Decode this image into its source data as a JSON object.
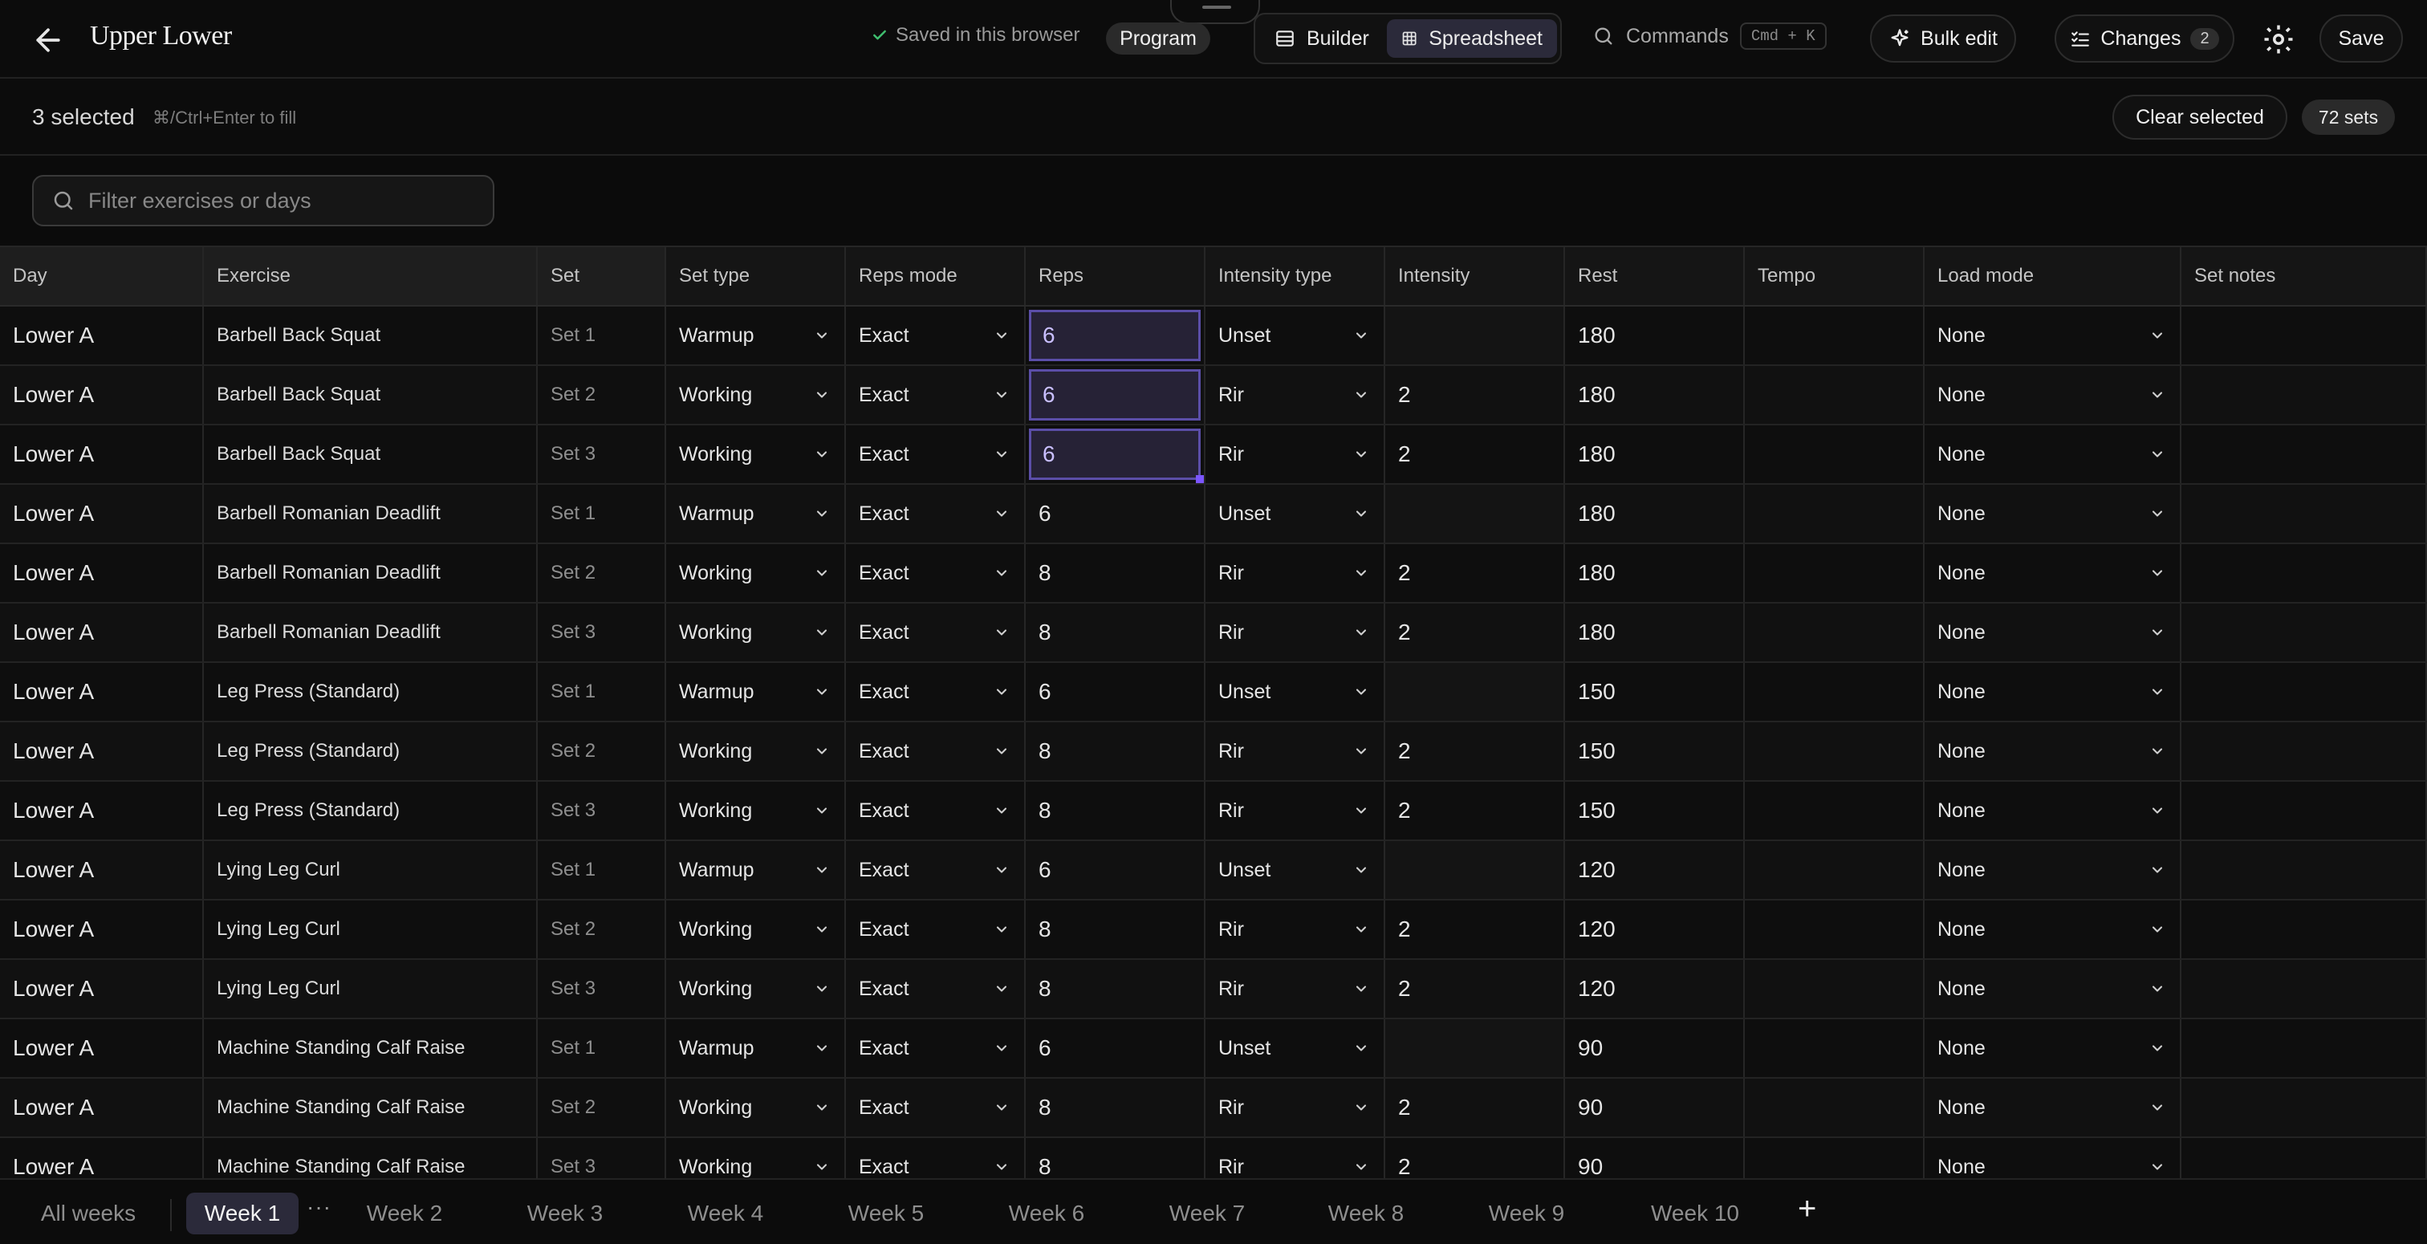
{
  "header": {
    "title": "Upper Lower",
    "saved_status": "Saved in this browser",
    "program_label": "Program",
    "view_builder": "Builder",
    "view_spreadsheet": "Spreadsheet",
    "commands_label": "Commands",
    "commands_shortcut": "Cmd + K",
    "bulk_edit_label": "Bulk edit",
    "changes_label": "Changes",
    "changes_count": "2",
    "save_label": "Save"
  },
  "selection": {
    "count_text": "3 selected",
    "hint": "⌘/Ctrl+Enter to fill",
    "clear_label": "Clear selected",
    "sets_badge": "72 sets"
  },
  "filter": {
    "placeholder": "Filter exercises or days"
  },
  "columns": [
    "Day",
    "Exercise",
    "Set",
    "Set type",
    "Reps mode",
    "Reps",
    "Intensity type",
    "Intensity",
    "Rest",
    "Tempo",
    "Load mode",
    "Set notes"
  ],
  "rows": [
    {
      "day": "Lower A",
      "exercise": "Barbell Back Squat",
      "set": "Set 1",
      "set_type": "Warmup",
      "reps_mode": "Exact",
      "reps": "6",
      "intensity_type": "Unset",
      "intensity": "",
      "rest": "180",
      "tempo": "",
      "load_mode": "None",
      "notes": ""
    },
    {
      "day": "Lower A",
      "exercise": "Barbell Back Squat",
      "set": "Set 2",
      "set_type": "Working",
      "reps_mode": "Exact",
      "reps": "6",
      "intensity_type": "Rir",
      "intensity": "2",
      "rest": "180",
      "tempo": "",
      "load_mode": "None",
      "notes": ""
    },
    {
      "day": "Lower A",
      "exercise": "Barbell Back Squat",
      "set": "Set 3",
      "set_type": "Working",
      "reps_mode": "Exact",
      "reps": "6",
      "intensity_type": "Rir",
      "intensity": "2",
      "rest": "180",
      "tempo": "",
      "load_mode": "None",
      "notes": ""
    },
    {
      "day": "Lower A",
      "exercise": "Barbell Romanian Deadlift",
      "set": "Set 1",
      "set_type": "Warmup",
      "reps_mode": "Exact",
      "reps": "6",
      "intensity_type": "Unset",
      "intensity": "",
      "rest": "180",
      "tempo": "",
      "load_mode": "None",
      "notes": ""
    },
    {
      "day": "Lower A",
      "exercise": "Barbell Romanian Deadlift",
      "set": "Set 2",
      "set_type": "Working",
      "reps_mode": "Exact",
      "reps": "8",
      "intensity_type": "Rir",
      "intensity": "2",
      "rest": "180",
      "tempo": "",
      "load_mode": "None",
      "notes": ""
    },
    {
      "day": "Lower A",
      "exercise": "Barbell Romanian Deadlift",
      "set": "Set 3",
      "set_type": "Working",
      "reps_mode": "Exact",
      "reps": "8",
      "intensity_type": "Rir",
      "intensity": "2",
      "rest": "180",
      "tempo": "",
      "load_mode": "None",
      "notes": ""
    },
    {
      "day": "Lower A",
      "exercise": "Leg Press (Standard)",
      "set": "Set 1",
      "set_type": "Warmup",
      "reps_mode": "Exact",
      "reps": "6",
      "intensity_type": "Unset",
      "intensity": "",
      "rest": "150",
      "tempo": "",
      "load_mode": "None",
      "notes": ""
    },
    {
      "day": "Lower A",
      "exercise": "Leg Press (Standard)",
      "set": "Set 2",
      "set_type": "Working",
      "reps_mode": "Exact",
      "reps": "8",
      "intensity_type": "Rir",
      "intensity": "2",
      "rest": "150",
      "tempo": "",
      "load_mode": "None",
      "notes": ""
    },
    {
      "day": "Lower A",
      "exercise": "Leg Press (Standard)",
      "set": "Set 3",
      "set_type": "Working",
      "reps_mode": "Exact",
      "reps": "8",
      "intensity_type": "Rir",
      "intensity": "2",
      "rest": "150",
      "tempo": "",
      "load_mode": "None",
      "notes": ""
    },
    {
      "day": "Lower A",
      "exercise": "Lying Leg Curl",
      "set": "Set 1",
      "set_type": "Warmup",
      "reps_mode": "Exact",
      "reps": "6",
      "intensity_type": "Unset",
      "intensity": "",
      "rest": "120",
      "tempo": "",
      "load_mode": "None",
      "notes": ""
    },
    {
      "day": "Lower A",
      "exercise": "Lying Leg Curl",
      "set": "Set 2",
      "set_type": "Working",
      "reps_mode": "Exact",
      "reps": "8",
      "intensity_type": "Rir",
      "intensity": "2",
      "rest": "120",
      "tempo": "",
      "load_mode": "None",
      "notes": ""
    },
    {
      "day": "Lower A",
      "exercise": "Lying Leg Curl",
      "set": "Set 3",
      "set_type": "Working",
      "reps_mode": "Exact",
      "reps": "8",
      "intensity_type": "Rir",
      "intensity": "2",
      "rest": "120",
      "tempo": "",
      "load_mode": "None",
      "notes": ""
    },
    {
      "day": "Lower A",
      "exercise": "Machine Standing Calf Raise",
      "set": "Set 1",
      "set_type": "Warmup",
      "reps_mode": "Exact",
      "reps": "6",
      "intensity_type": "Unset",
      "intensity": "",
      "rest": "90",
      "tempo": "",
      "load_mode": "None",
      "notes": ""
    },
    {
      "day": "Lower A",
      "exercise": "Machine Standing Calf Raise",
      "set": "Set 2",
      "set_type": "Working",
      "reps_mode": "Exact",
      "reps": "8",
      "intensity_type": "Rir",
      "intensity": "2",
      "rest": "90",
      "tempo": "",
      "load_mode": "None",
      "notes": ""
    },
    {
      "day": "Lower A",
      "exercise": "Machine Standing Calf Raise",
      "set": "Set 3",
      "set_type": "Working",
      "reps_mode": "Exact",
      "reps": "8",
      "intensity_type": "Rir",
      "intensity": "2",
      "rest": "90",
      "tempo": "",
      "load_mode": "None",
      "notes": ""
    }
  ],
  "selected_rows": [
    0,
    1,
    2
  ],
  "weeks": [
    "All weeks",
    "Week 1",
    "Week 2",
    "Week 3",
    "Week 4",
    "Week 5",
    "Week 6",
    "Week 7",
    "Week 8",
    "Week 9",
    "Week 10"
  ],
  "active_week": "Week 1",
  "more_label": "···",
  "add_week_label": "+",
  "icons": {
    "back": "arrow-left-icon",
    "saved": "check-icon",
    "builder": "list-layout-icon",
    "spreadsheet": "grid-icon",
    "commands": "search-icon",
    "bulk": "sparkle-icon",
    "changes": "checklist-icon",
    "settings": "gear-icon",
    "filter": "search-icon",
    "dropdown": "chevron-down-icon"
  },
  "colors": {
    "accent": "#7b55ff",
    "selection_bg": "#262236",
    "saved_check": "#3fbf6f"
  }
}
